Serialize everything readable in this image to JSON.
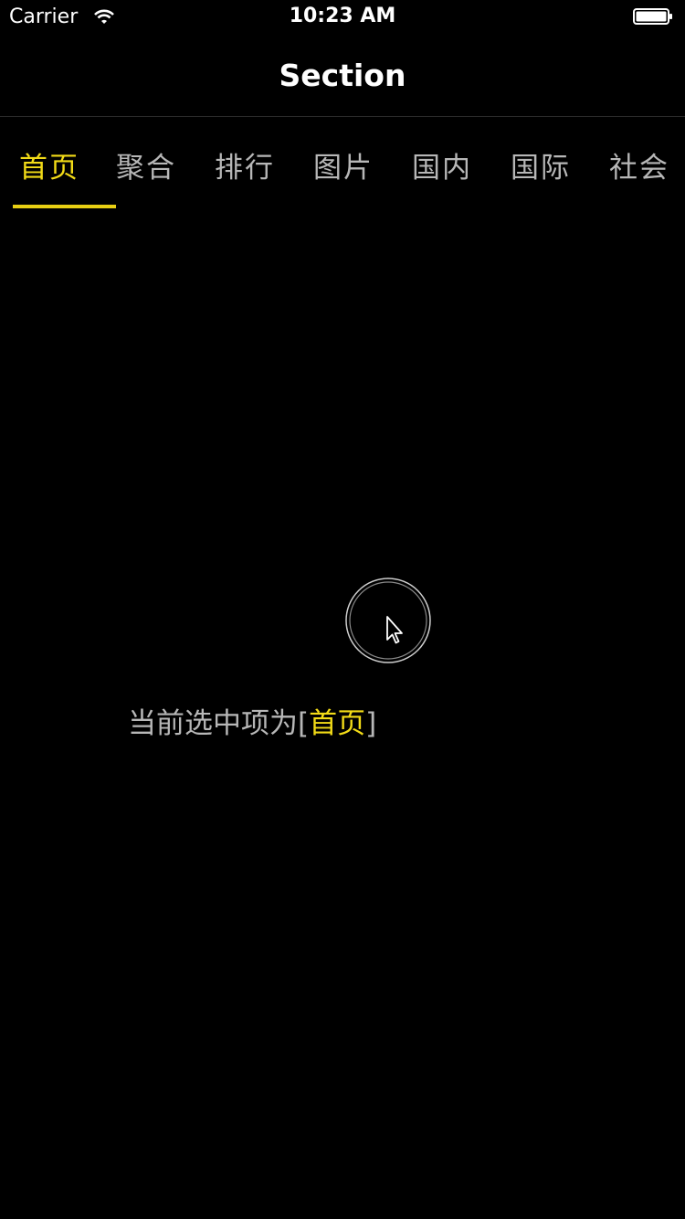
{
  "status_bar": {
    "carrier": "Carrier",
    "time": "10:23 AM"
  },
  "nav": {
    "title": "Section"
  },
  "tabs": [
    {
      "label": "首页",
      "selected": true
    },
    {
      "label": "聚合",
      "selected": false
    },
    {
      "label": "排行",
      "selected": false
    },
    {
      "label": "图片",
      "selected": false
    },
    {
      "label": "国内",
      "selected": false
    },
    {
      "label": "国际",
      "selected": false
    },
    {
      "label": "社会",
      "selected": false
    }
  ],
  "content": {
    "prefix": "当前选中项为[",
    "selected_item": "首页",
    "suffix": "]"
  },
  "colors": {
    "accent": "#f2db17",
    "text_muted": "#b7b7b7",
    "background": "#000000"
  },
  "icons": {
    "wifi": "wifi-icon",
    "battery": "battery-icon",
    "cursor": "pointer-cursor-icon"
  }
}
